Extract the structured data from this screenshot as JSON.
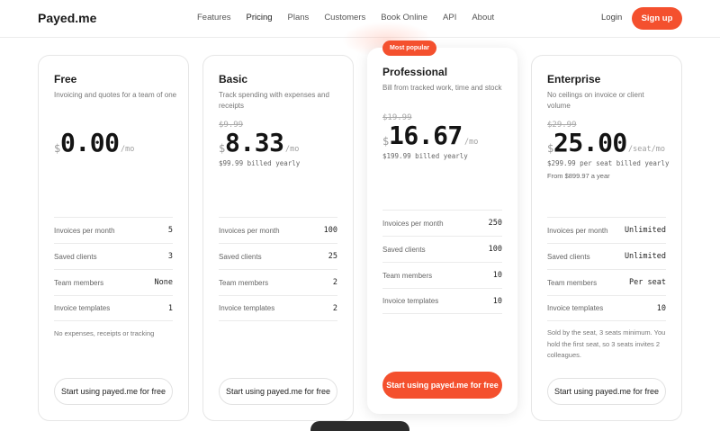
{
  "header": {
    "logo": "Payed.me",
    "nav": [
      "Features",
      "Pricing",
      "Plans",
      "Customers",
      "Book Online",
      "API",
      "About"
    ],
    "active_nav": "Pricing",
    "login": "Login",
    "signup": "Sign up"
  },
  "colors": {
    "accent": "#f4502e"
  },
  "plans": [
    {
      "name": "Free",
      "description": "Invoicing and quotes for a team of one",
      "old_price": "",
      "currency": "$",
      "price": "0.00",
      "period": "/mo",
      "billed": "",
      "extra": "",
      "features": [
        {
          "label": "Invoices per month",
          "value": "5"
        },
        {
          "label": "Saved clients",
          "value": "3"
        },
        {
          "label": "Team members",
          "value": "None"
        },
        {
          "label": "Invoice templates",
          "value": "1"
        }
      ],
      "footnote": "No expenses, receipts or tracking",
      "cta": "Start using payed.me for free"
    },
    {
      "name": "Basic",
      "description": "Track spending with expenses and receipts",
      "old_price": "$9.99",
      "currency": "$",
      "price": "8.33",
      "period": "/mo",
      "billed": "$99.99 billed yearly",
      "extra": "",
      "features": [
        {
          "label": "Invoices per month",
          "value": "100"
        },
        {
          "label": "Saved clients",
          "value": "25"
        },
        {
          "label": "Team members",
          "value": "2"
        },
        {
          "label": "Invoice templates",
          "value": "2"
        }
      ],
      "footnote": "",
      "cta": "Start using payed.me for free"
    },
    {
      "name": "Professional",
      "badge": "Most popular",
      "description": "Bill from tracked work, time and stock",
      "old_price": "$19.99",
      "currency": "$",
      "price": "16.67",
      "period": "/mo",
      "billed": "$199.99 billed yearly",
      "extra": "",
      "features": [
        {
          "label": "Invoices per month",
          "value": "250"
        },
        {
          "label": "Saved clients",
          "value": "100"
        },
        {
          "label": "Team members",
          "value": "10"
        },
        {
          "label": "Invoice templates",
          "value": "10"
        }
      ],
      "footnote": "",
      "cta": "Start using payed.me for free"
    },
    {
      "name": "Enterprise",
      "description": "No ceilings on invoice or client volume",
      "old_price": "$29.99",
      "currency": "$",
      "price": "25.00",
      "period": "/seat/mo",
      "billed": "$299.99 per seat billed yearly",
      "extra": "From $899.97 a year",
      "features": [
        {
          "label": "Invoices per month",
          "value": "Unlimited"
        },
        {
          "label": "Saved clients",
          "value": "Unlimited"
        },
        {
          "label": "Team members",
          "value": "Per seat"
        },
        {
          "label": "Invoice templates",
          "value": "10"
        }
      ],
      "footnote": "Sold by the seat, 3 seats minimum. You hold the first seat, so 3 seats invites 2 colleagues.",
      "cta": "Start using payed.me for free"
    }
  ]
}
